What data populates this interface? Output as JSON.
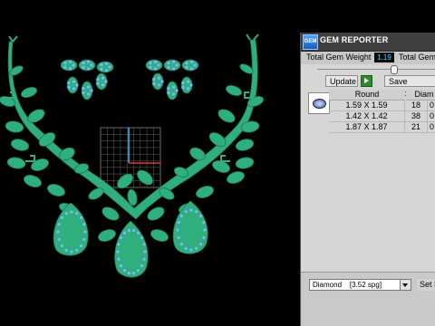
{
  "panel": {
    "title": "GEM REPORTER",
    "logo_icon": "gem-reporter-logo-icon",
    "weight_label": "Total Gem Weight",
    "weight_value": "1.19",
    "weight_label_2": "Total Gem",
    "update_label": "Update",
    "save_report_label": "Save Report",
    "table": {
      "headers": [
        "Round",
        "Diam"
      ],
      "rows": [
        {
          "size": "1.59 X 1.59",
          "count": "18",
          "extra": "0"
        },
        {
          "size": "1.42 X 1.42",
          "count": "38",
          "extra": "0"
        },
        {
          "size": "1.87 X 1.87",
          "count": "21",
          "extra": "0"
        }
      ]
    },
    "material_select": "Diamond    [3.52 spg]",
    "set_label": "Set I"
  },
  "colors": {
    "jewelry": "#2fae7e",
    "gems": "#7fb6ff",
    "viewport_bg": "#000000",
    "panel_bg": "#d6d6d6",
    "grid_x_axis": "#e53030",
    "grid_y_axis": "#22c4ff"
  }
}
